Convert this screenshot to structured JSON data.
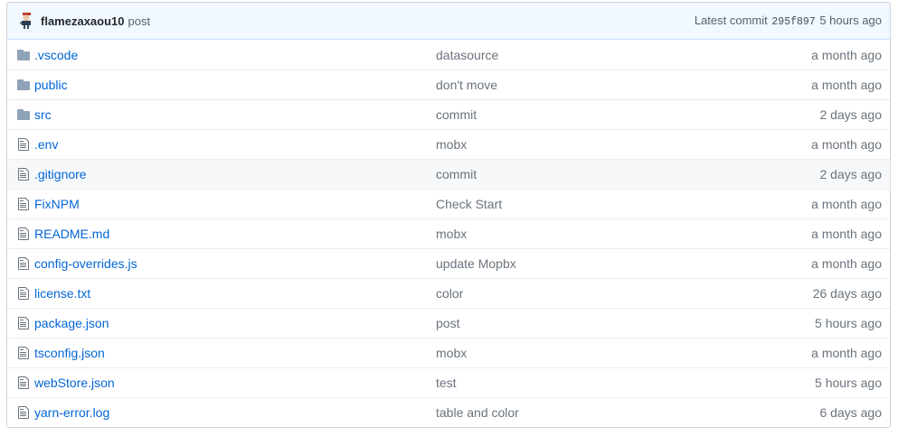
{
  "commit": {
    "author": "flamezaxaou10",
    "message": "post",
    "latest_label": "Latest commit",
    "sha": "295f897",
    "age": "5 hours ago"
  },
  "files": [
    {
      "type": "folder",
      "icon": "folder-icon",
      "name": ".vscode",
      "message": "datasource",
      "age": "a month ago"
    },
    {
      "type": "folder",
      "icon": "folder-icon",
      "name": "public",
      "message": "don't move",
      "age": "a month ago"
    },
    {
      "type": "folder",
      "icon": "folder-icon",
      "name": "src",
      "message": "commit",
      "age": "2 days ago"
    },
    {
      "type": "file",
      "icon": "file-icon",
      "name": ".env",
      "message": "mobx",
      "age": "a month ago"
    },
    {
      "type": "file",
      "icon": "file-icon",
      "name": ".gitignore",
      "message": "commit",
      "age": "2 days ago"
    },
    {
      "type": "file",
      "icon": "file-icon",
      "name": "FixNPM",
      "message": "Check Start",
      "age": "a month ago"
    },
    {
      "type": "file",
      "icon": "file-icon",
      "name": "README.md",
      "message": "mobx",
      "age": "a month ago"
    },
    {
      "type": "file",
      "icon": "file-icon",
      "name": "config-overrides.js",
      "message": "update Mopbx",
      "age": "a month ago"
    },
    {
      "type": "file",
      "icon": "file-icon",
      "name": "license.txt",
      "message": "color",
      "age": "26 days ago"
    },
    {
      "type": "file",
      "icon": "file-icon",
      "name": "package.json",
      "message": "post",
      "age": "5 hours ago"
    },
    {
      "type": "file",
      "icon": "file-icon",
      "name": "tsconfig.json",
      "message": "mobx",
      "age": "a month ago"
    },
    {
      "type": "file",
      "icon": "file-icon",
      "name": "webStore.json",
      "message": "test",
      "age": "5 hours ago"
    },
    {
      "type": "file",
      "icon": "file-icon",
      "name": "yarn-error.log",
      "message": "table and color",
      "age": "6 days ago"
    }
  ],
  "colors": {
    "link": "#0366d6",
    "muted": "#6a737d",
    "folder_icon": "#79b8ff",
    "file_icon": "#6a737d",
    "commit_bar_bg": "#f1f8ff",
    "hover_row_bg": "#f6f8fa"
  }
}
